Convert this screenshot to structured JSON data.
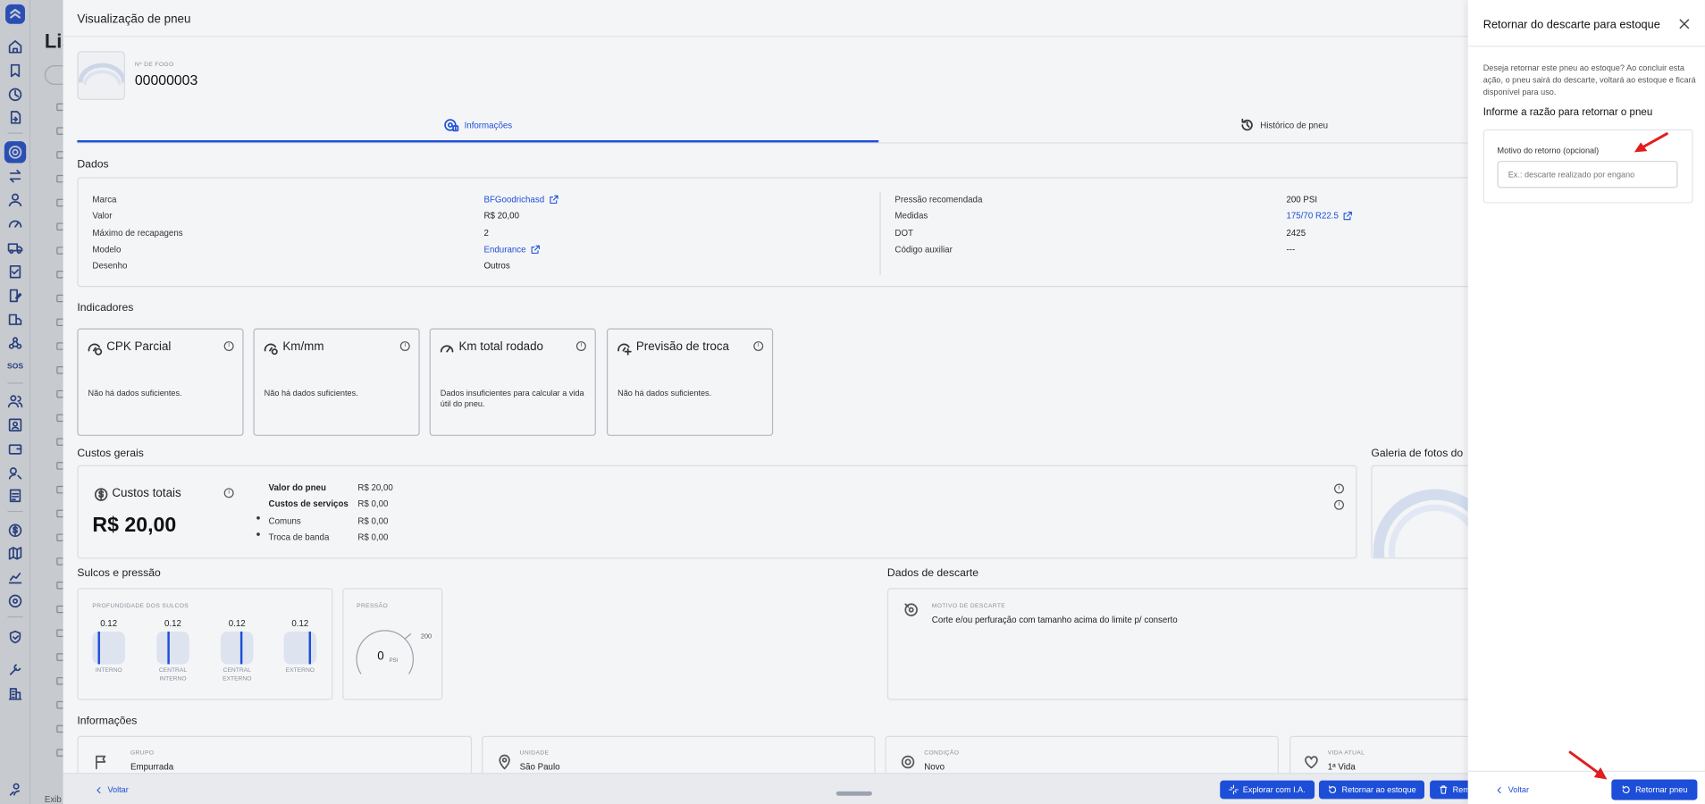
{
  "background_page": {
    "title": "Lis",
    "footer_text": "Exib"
  },
  "modal": {
    "title": "Visualização de pneu",
    "fire_label": "Nº DE FOGO",
    "fire_number": "00000003",
    "tabs": [
      {
        "label": "Informações",
        "icon": "tire-info-icon",
        "active": true
      },
      {
        "label": "Histórico de pneu",
        "icon": "history-icon",
        "active": false
      }
    ],
    "dados": {
      "title": "Dados",
      "left": [
        {
          "label": "Marca",
          "value": "BFGoodrichasd",
          "link": true
        },
        {
          "label": "Valor",
          "value": "R$ 20,00",
          "link": false
        },
        {
          "label": "Máximo de recapagens",
          "value": "2",
          "link": false
        },
        {
          "label": "Modelo",
          "value": "Endurance",
          "link": true
        },
        {
          "label": "Desenho",
          "value": "Outros",
          "link": false
        }
      ],
      "right": [
        {
          "label": "Pressão recomendada",
          "value": "200 PSI",
          "link": false
        },
        {
          "label": "Medidas",
          "value": "175/70 R22.5",
          "link": true
        },
        {
          "label": "DOT",
          "value": "2425",
          "link": false
        },
        {
          "label": "Código auxiliar",
          "value": "---",
          "link": false
        }
      ]
    },
    "indicadores": {
      "title": "Indicadores",
      "cards": [
        {
          "title": "CPK Parcial",
          "message": "Não há dados suficientes.",
          "icon": "gauge-dollar-icon"
        },
        {
          "title": "Km/mm",
          "message": "Não há dados suficientes.",
          "icon": "gauge-settings-icon"
        },
        {
          "title": "Km total rodado",
          "message": "Dados insuficientes para calcular a vida útil do pneu.",
          "icon": "speedometer-icon"
        },
        {
          "title": "Previsão de troca",
          "message": "Não há dados suficientes.",
          "icon": "gauge-plus-icon"
        }
      ]
    },
    "custos": {
      "title": "Custos gerais",
      "total_label": "Custos totais",
      "total_value": "R$ 20,00",
      "rows": [
        {
          "label": "Valor do pneu",
          "value": "R$ 20,00",
          "bold": true,
          "bullet": false
        },
        {
          "label": "Custos de serviços",
          "value": "R$ 0,00",
          "bold": true,
          "bullet": false
        },
        {
          "label": "Comuns",
          "value": "R$ 0,00",
          "bold": false,
          "bullet": true
        },
        {
          "label": "Troca de banda",
          "value": "R$ 0,00",
          "bold": false,
          "bullet": true
        }
      ]
    },
    "galeria_title": "Galeria de fotos do",
    "sulcos": {
      "title": "Sulcos e pressão",
      "depth_label": "PROFUNDIDADE DOS SULCOS",
      "grooves": [
        {
          "value": "0.12",
          "label": "INTERNO"
        },
        {
          "value": "0.12",
          "label": "CENTRAL INTERNO"
        },
        {
          "value": "0.12",
          "label": "CENTRAL EXTERNO"
        },
        {
          "value": "0.12",
          "label": "EXTERNO"
        }
      ],
      "pressure_label": "PRESSÃO",
      "pressure_value": "0",
      "pressure_unit": "PSI",
      "pressure_max": "200"
    },
    "descarte": {
      "title": "Dados de descarte",
      "reason_label": "MOTIVO DE DESCARTE",
      "reason_value": "Corte e/ou perfuração com tamanho acima do limite p/ conserto"
    },
    "informacoes": {
      "title": "Informações",
      "cards": [
        {
          "label": "GRUPO",
          "value": "Empurrada",
          "icon": "flag-icon"
        },
        {
          "label": "UNIDADE",
          "value": "São Paulo",
          "icon": "location-pin-icon"
        },
        {
          "label": "CONDIÇÃO",
          "value": "Novo",
          "icon": "tire-icon"
        },
        {
          "label": "VIDA ATUAL",
          "value": "1ª Vida",
          "icon": "heart-icon"
        }
      ]
    },
    "footer": {
      "back": "Voltar",
      "explore": "Explorar com I.A.",
      "return_stock": "Retornar ao estoque",
      "remove": "Rem"
    }
  },
  "panel": {
    "title": "Retornar do descarte para estoque",
    "description": "Deseja retornar este pneu ao estoque? Ao concluir esta ação, o pneu sairá do descarte, voltará ao estoque e ficará disponível para uso.",
    "subtitle": "Informe a razão para retornar o pneu",
    "field_label": "Motivo do retorno (opcional)",
    "field_placeholder": "Ex.: descarte realizado por engano",
    "field_value": "",
    "back": "Voltar",
    "submit": "Retornar pneu"
  },
  "colors": {
    "accent": "#1d4ed8",
    "annotation_arrow": "#e11d1d",
    "overlay": "#46506080"
  }
}
